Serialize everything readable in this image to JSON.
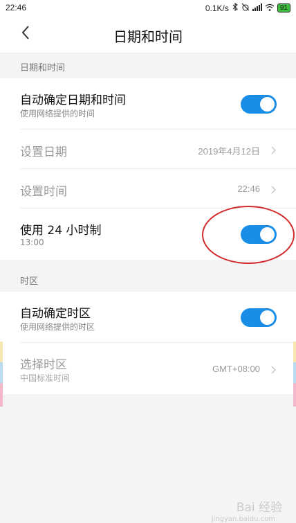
{
  "status_bar": {
    "time": "22:46",
    "network_speed": "0.1K/s",
    "battery": "91",
    "icons": [
      "bluetooth-icon",
      "alarm-icon",
      "signal-icon",
      "wifi-icon",
      "battery-icon"
    ]
  },
  "header": {
    "title": "日期和时间",
    "back_icon": "chevron-left-icon"
  },
  "section_datetime": {
    "label": "日期和时间",
    "rows": [
      {
        "title": "自动确定日期和时间",
        "subtitle": "使用网络提供的时间",
        "toggle_on": true
      },
      {
        "title": "设置日期",
        "value": "2019年4月12日",
        "disabled": true
      },
      {
        "title": "设置时间",
        "value": "22:46",
        "disabled": true
      },
      {
        "title": "使用 24 小时制",
        "subtitle": "13:00",
        "toggle_on": true
      }
    ]
  },
  "section_timezone": {
    "label": "时区",
    "rows": [
      {
        "title": "自动确定时区",
        "subtitle": "使用网络提供的时区",
        "toggle_on": true
      },
      {
        "title": "选择时区",
        "subtitle": "中国标准时间",
        "value": "GMT+08:00",
        "disabled": true
      }
    ]
  },
  "watermark": {
    "text": "Bai 经验",
    "url": "jingyan.baidu.com"
  },
  "colors": {
    "toggle_on": "#1a8de6",
    "annotation": "#d22b2b"
  }
}
